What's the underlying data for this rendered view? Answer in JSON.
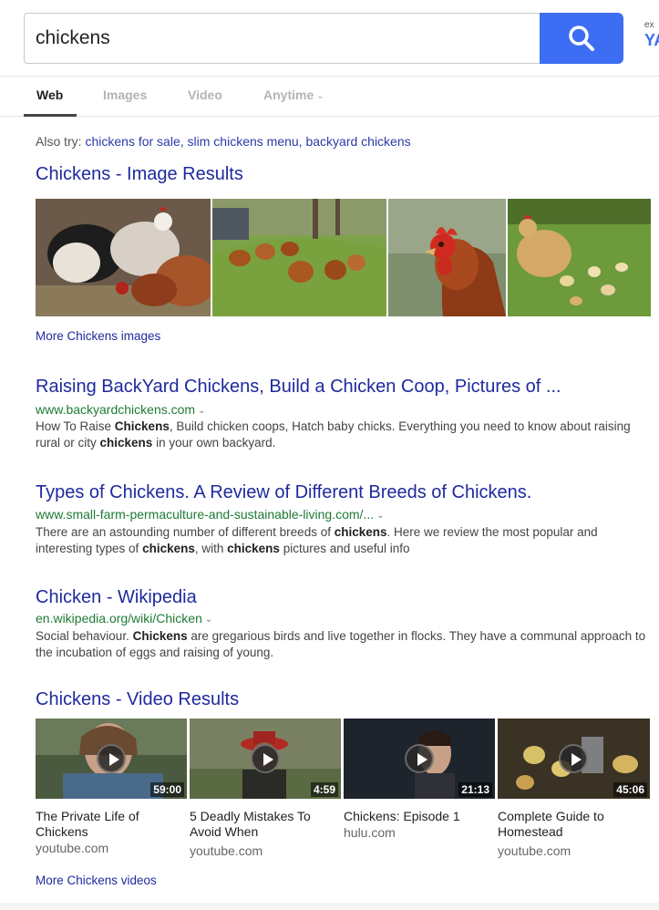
{
  "search": {
    "query": "chickens",
    "brand_small": "ex",
    "brand_big": "YA",
    "accent_color": "#3d6df2"
  },
  "tabs": [
    {
      "label": "Web",
      "active": true
    },
    {
      "label": "Images"
    },
    {
      "label": "Video"
    },
    {
      "label": "Anytime",
      "dropdown": true
    }
  ],
  "also_try": {
    "prefix": "Also try:",
    "links": [
      "chickens for sale,",
      "slim chickens menu,",
      "backyard chickens"
    ]
  },
  "image_results": {
    "title": "Chickens - Image Results",
    "more_link": "More Chickens images",
    "images": [
      "flock-of-chickens-photo",
      "chickens-in-field-photo",
      "hen-closeup-photo",
      "hen-with-chicks-photo"
    ]
  },
  "results": [
    {
      "title": "Raising BackYard Chickens, Build a Chicken Coop, Pictures of ...",
      "url": "www.backyardchickens.com",
      "snippet_html": "How To Raise <b>Chickens</b>, Build chicken coops, Hatch baby chicks. Everything you need to know about raising rural or city <b>chickens</b> in your own backyard."
    },
    {
      "title": "Types of Chickens. A Review of Different Breeds of Chickens.",
      "url": "www.small-farm-permaculture-and-sustainable-living.com/...",
      "snippet_html": "There are an astounding number of different breeds of <b>chickens</b>. Here we review the most popular and interesting types of <b>chickens</b>, with <b>chickens</b> pictures and useful info"
    },
    {
      "title": "Chicken - Wikipedia",
      "url": "en.wikipedia.org/wiki/Chicken",
      "snippet_html": "Social behaviour. <b>Chickens</b> are gregarious birds and live together in flocks. They have a communal approach to the incubation of eggs and raising of young."
    }
  ],
  "video_results": {
    "title": "Chickens - Video Results",
    "more_link": "More Chickens videos",
    "videos": [
      {
        "duration": "59:00",
        "title": "The Private Life of Chickens",
        "source": "youtube.com"
      },
      {
        "duration": "4:59",
        "title": "5 Deadly Mistakes To Avoid When",
        "source": "youtube.com"
      },
      {
        "duration": "21:13",
        "title": "Chickens: Episode 1",
        "source": "hulu.com"
      },
      {
        "duration": "45:06",
        "title": "Complete Guide to Homestead",
        "source": "youtube.com"
      }
    ]
  }
}
